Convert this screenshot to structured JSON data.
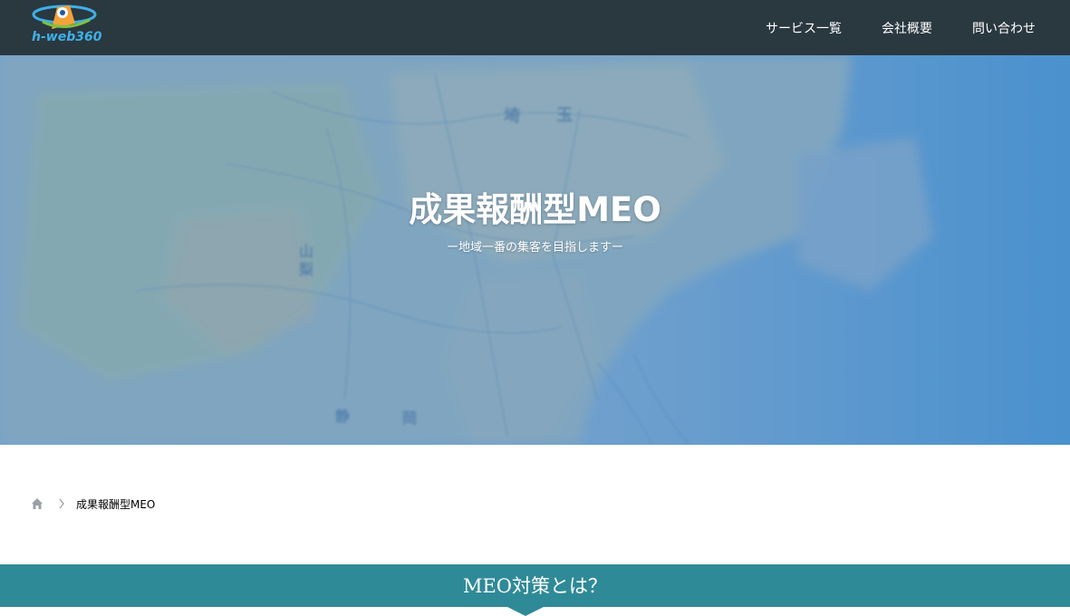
{
  "header": {
    "logo_text": "h-web360",
    "nav": [
      {
        "label": "サービス一覧"
      },
      {
        "label": "会社概要"
      },
      {
        "label": "問い合わせ"
      }
    ]
  },
  "hero": {
    "title": "成果報酬型MEO",
    "subtitle": "ー地域一番の集客を目指しますー",
    "map_labels": [
      "埼",
      "玉",
      "山",
      "梨",
      "静",
      "岡"
    ]
  },
  "breadcrumb": {
    "current": "成果報酬型MEO"
  },
  "section": {
    "title": "MEO対策とは？"
  },
  "colors": {
    "header_bg": "#2a3840",
    "section_bg": "#2f8a98",
    "logo_text": "#3fb0e6"
  }
}
